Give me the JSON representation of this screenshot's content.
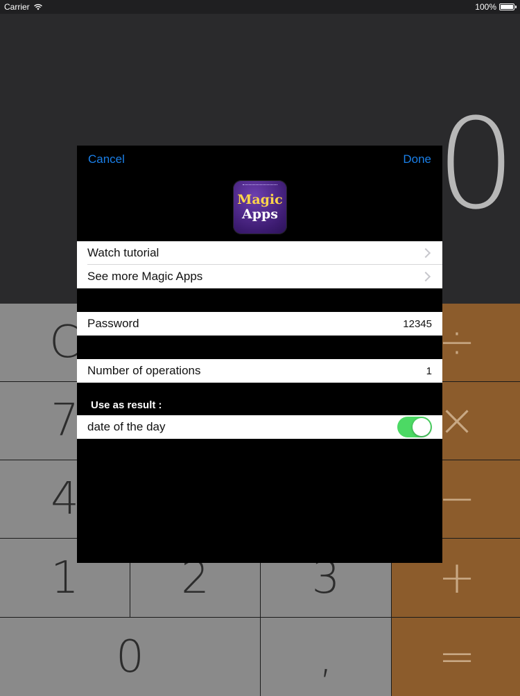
{
  "status_bar": {
    "carrier": "Carrier",
    "battery": "100%"
  },
  "calculator": {
    "display": "0",
    "keys": [
      {
        "label": "C",
        "op": false
      },
      {
        "label": "",
        "op": false
      },
      {
        "label": "",
        "op": false
      },
      {
        "label": "÷",
        "op": true
      },
      {
        "label": "7",
        "op": false
      },
      {
        "label": "",
        "op": false
      },
      {
        "label": "",
        "op": false
      },
      {
        "label": "×",
        "op": true
      },
      {
        "label": "4",
        "op": false
      },
      {
        "label": "",
        "op": false
      },
      {
        "label": "",
        "op": false
      },
      {
        "label": "−",
        "op": true
      },
      {
        "label": "1",
        "op": false
      },
      {
        "label": "2",
        "op": false
      },
      {
        "label": "3",
        "op": false
      },
      {
        "label": "+",
        "op": true
      },
      {
        "label": "0",
        "op": false
      },
      {
        "label": ",",
        "op": false
      },
      {
        "label": "=",
        "op": true
      }
    ]
  },
  "modal": {
    "cancel_label": "Cancel",
    "done_label": "Done",
    "logo": {
      "line1": "Magic",
      "line2": "Apps"
    },
    "rows": {
      "watch_tutorial": "Watch tutorial",
      "see_more": "See more Magic Apps",
      "password_label": "Password",
      "password_value": "12345",
      "operations_label": "Number of operations",
      "operations_value": "1",
      "section_header": "Use as result :",
      "date_label": "date of the day",
      "date_toggle_on": true
    }
  },
  "colors": {
    "accent": "#1a7fe8",
    "toggle_on": "#4cd964",
    "operator_key": "#8c5c2c",
    "digit_key": "#8a8a8a"
  }
}
